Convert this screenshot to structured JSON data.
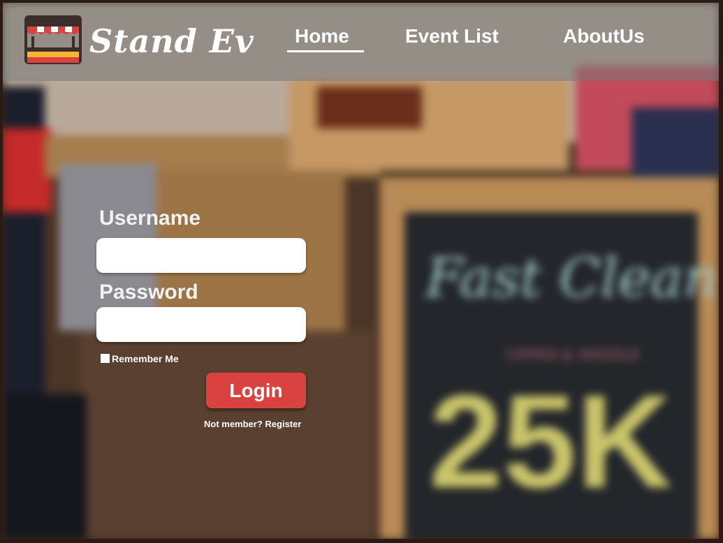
{
  "brand": {
    "name": "Stand Ev",
    "logo": "market-stall-icon"
  },
  "nav": {
    "items": [
      {
        "label": "Home",
        "active": true
      },
      {
        "label": "Event List",
        "active": false
      },
      {
        "label": "AboutUs",
        "active": false
      }
    ]
  },
  "login": {
    "username_label": "Username",
    "username_value": "",
    "password_label": "Password",
    "password_value": "",
    "remember_label": "Remember Me",
    "remember_checked": false,
    "submit_label": "Login",
    "register_link": "Not member? Register"
  },
  "background": {
    "sign_text": "Fast Clean",
    "sign_subtext": "UPPER & MIDDLE",
    "sign_price": "25K"
  },
  "colors": {
    "header_overlay": "#787878",
    "button": "#d9423e",
    "text": "#ffffff"
  }
}
